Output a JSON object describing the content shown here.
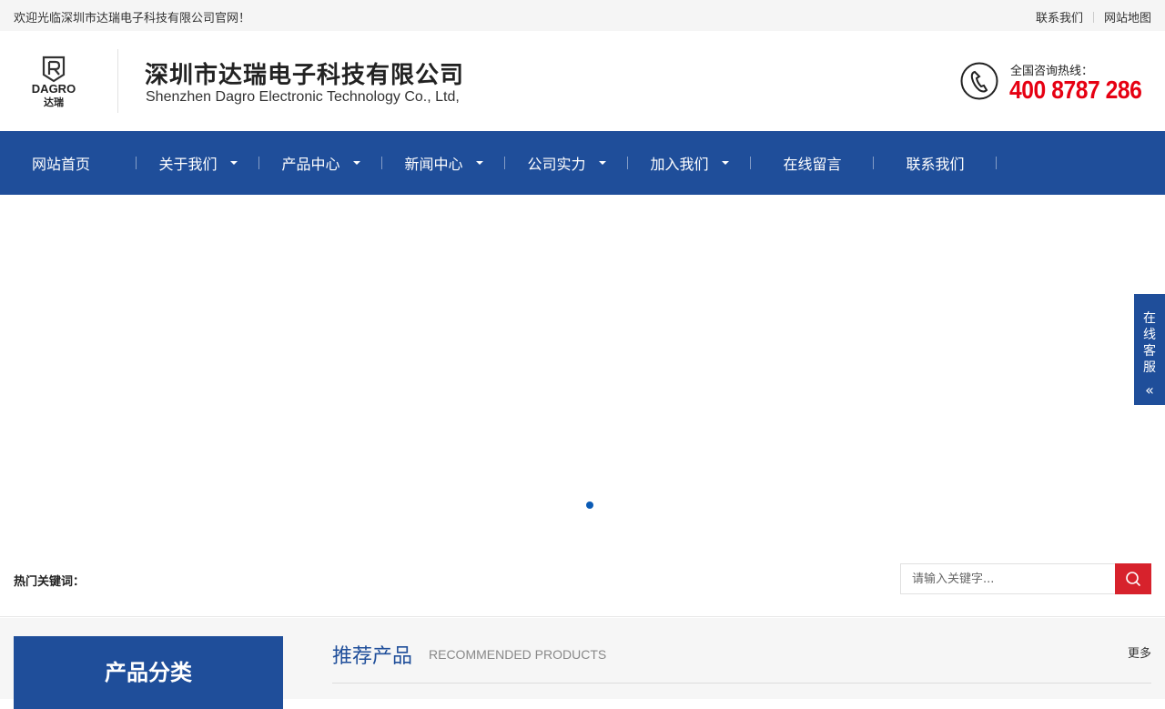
{
  "topbar": {
    "welcome": "欢迎光临深圳市达瑞电子科技有限公司官网！",
    "links": [
      "联系我们",
      "网站地图"
    ]
  },
  "header": {
    "logo_text": "DAGRO",
    "logo_cn": "达瑞",
    "company_name": "深圳市达瑞电子科技有限公司",
    "company_en": "Shenzhen Dagro Electronic Technology Co., Ltd,",
    "hotline_label": "全国咨询热线：",
    "hotline_number": "400 8787 286",
    "hotline_icon": "phone-icon"
  },
  "nav": {
    "items": [
      {
        "label": "网站首页"
      },
      {
        "label": "关于我们"
      },
      {
        "label": "产品中心"
      },
      {
        "label": "新闻中心"
      },
      {
        "label": "公司实力"
      },
      {
        "label": "加入我们"
      },
      {
        "label": "在线留言"
      },
      {
        "label": "联系我们"
      }
    ]
  },
  "side_tab": {
    "label": "在线客服",
    "arrow": "«"
  },
  "hotbar": {
    "label": "热门关键词：",
    "search_placeholder": "请输入关键字..."
  },
  "content": {
    "category_title": "产品分类",
    "rec_title": "推荐产品",
    "rec_sub": "RECOMMENDED PRODUCTS",
    "more": "更多"
  },
  "colors": {
    "brand_blue": "#1f4e9a",
    "hotline_red": "#e60012",
    "search_red": "#d7222c"
  }
}
